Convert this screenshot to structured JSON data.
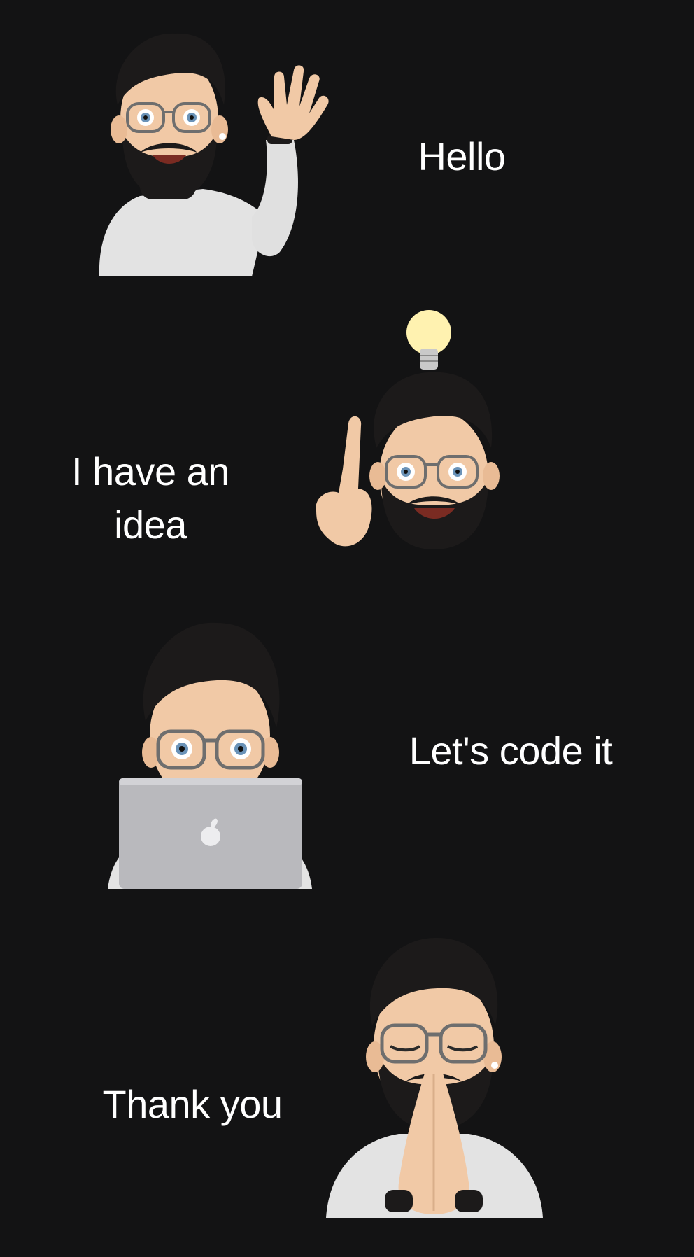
{
  "panels": [
    {
      "caption": "Hello",
      "avatar": "waving-memoji"
    },
    {
      "caption": "I have an\nidea",
      "avatar": "idea-memoji",
      "prop": "lightbulb-icon"
    },
    {
      "caption": "Let's code it",
      "avatar": "laptop-memoji",
      "prop": "apple-logo-icon"
    },
    {
      "caption": "Thank you",
      "avatar": "praying-memoji"
    }
  ],
  "colors": {
    "background": "#131314",
    "text": "#ffffff",
    "hair": "#1c1a1a",
    "skin": "#f1c9a6",
    "shirt": "#e3e3e3",
    "laptop": "#b9b9bd",
    "bulb": "#fff2b0"
  }
}
